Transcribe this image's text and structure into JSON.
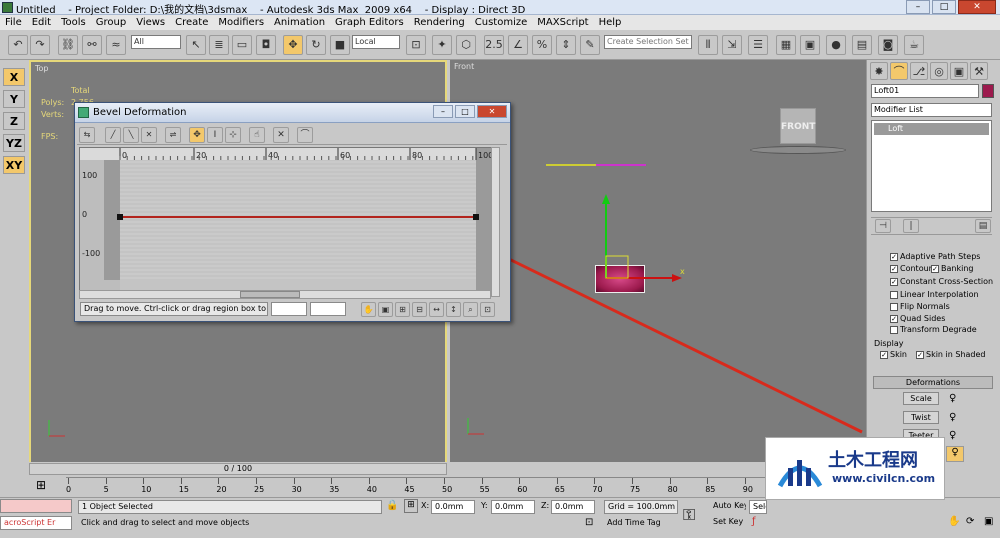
{
  "window": {
    "title": "Untitled    - Project Folder: D:\\我的文档\\3dsmax    - Autodesk 3ds Max  2009 x64    - Display : Direct 3D",
    "min": "–",
    "max": "□",
    "close": "✕"
  },
  "menu": [
    "File",
    "Edit",
    "Tools",
    "Group",
    "Views",
    "Create",
    "Modifiers",
    "Animation",
    "Graph Editors",
    "Rendering",
    "Customize",
    "MAXScript",
    "Help"
  ],
  "toolbar": {
    "selection_filter": "All",
    "ref_coord": "Local",
    "selection_set_placeholder": "Create Selection Set",
    "snap_label": "2.5"
  },
  "left_axes": [
    "X",
    "Y",
    "Z",
    "YZ",
    "XY"
  ],
  "viewports": {
    "top": {
      "label": "Top",
      "stats_total": "Total",
      "stats_polys": "Polys:",
      "stats_verts": "Verts:",
      "stats_fps": "FPS:",
      "polys_value": "2,756"
    },
    "front": {
      "label": "Front",
      "viewcube": "FRONT",
      "axis_x": "x"
    }
  },
  "bevel_dialog": {
    "title": "Bevel Deformation",
    "ruler": [
      "0",
      "20",
      "40",
      "60",
      "80",
      "100"
    ],
    "y_labels": [
      "100",
      "0",
      "-100"
    ],
    "status_hint": "Drag to move. Ctrl-click or drag region box to add to s"
  },
  "command_panel": {
    "object_name": "Loft01",
    "modifier_list": "Modifier List",
    "stack_item": "Loft",
    "options": [
      {
        "label": "Adaptive Path Steps",
        "checked": true
      },
      {
        "label": "Contour",
        "checked": true
      },
      {
        "label": "Banking",
        "checked": true
      },
      {
        "label": "Constant Cross-Section",
        "checked": true
      },
      {
        "label": "Linear Interpolation",
        "checked": false
      },
      {
        "label": "Flip Normals",
        "checked": false
      },
      {
        "label": "Quad Sides",
        "checked": true
      },
      {
        "label": "Transform Degrade",
        "checked": false
      }
    ],
    "display_label": "Display",
    "skin": "Skin",
    "skin_shaded": "Skin in Shaded",
    "deformations": "Deformations",
    "scale": "Scale",
    "twist": "Twist",
    "teeter": "Teeter"
  },
  "timeline": {
    "frame": "0 / 100",
    "ticks": [
      "0",
      "5",
      "10",
      "15",
      "20",
      "25",
      "30",
      "35",
      "40",
      "45",
      "50",
      "55",
      "60",
      "65",
      "70",
      "75",
      "80",
      "85",
      "90"
    ]
  },
  "status": {
    "maxscript": "acroScript Er",
    "selected": "1 Object Selected",
    "prompt": "Click and drag to select and move objects",
    "x": "0.0mm",
    "y": "0.0mm",
    "z": "0.0mm",
    "x_label": "X:",
    "y_label": "Y:",
    "z_label": "Z:",
    "grid": "Grid = 100.0mm",
    "add_time_tag": "Add Time Tag",
    "auto_key": "Auto Key",
    "set_key": "Set Key",
    "sel": "Sele"
  },
  "watermark": {
    "title": "土木工程网",
    "url": "www.civilcn.com"
  },
  "colors": {
    "accent": "#f3c86b",
    "curve": "#b3241d",
    "arrow": "#d82a1c",
    "object": "#9c1a4d"
  }
}
